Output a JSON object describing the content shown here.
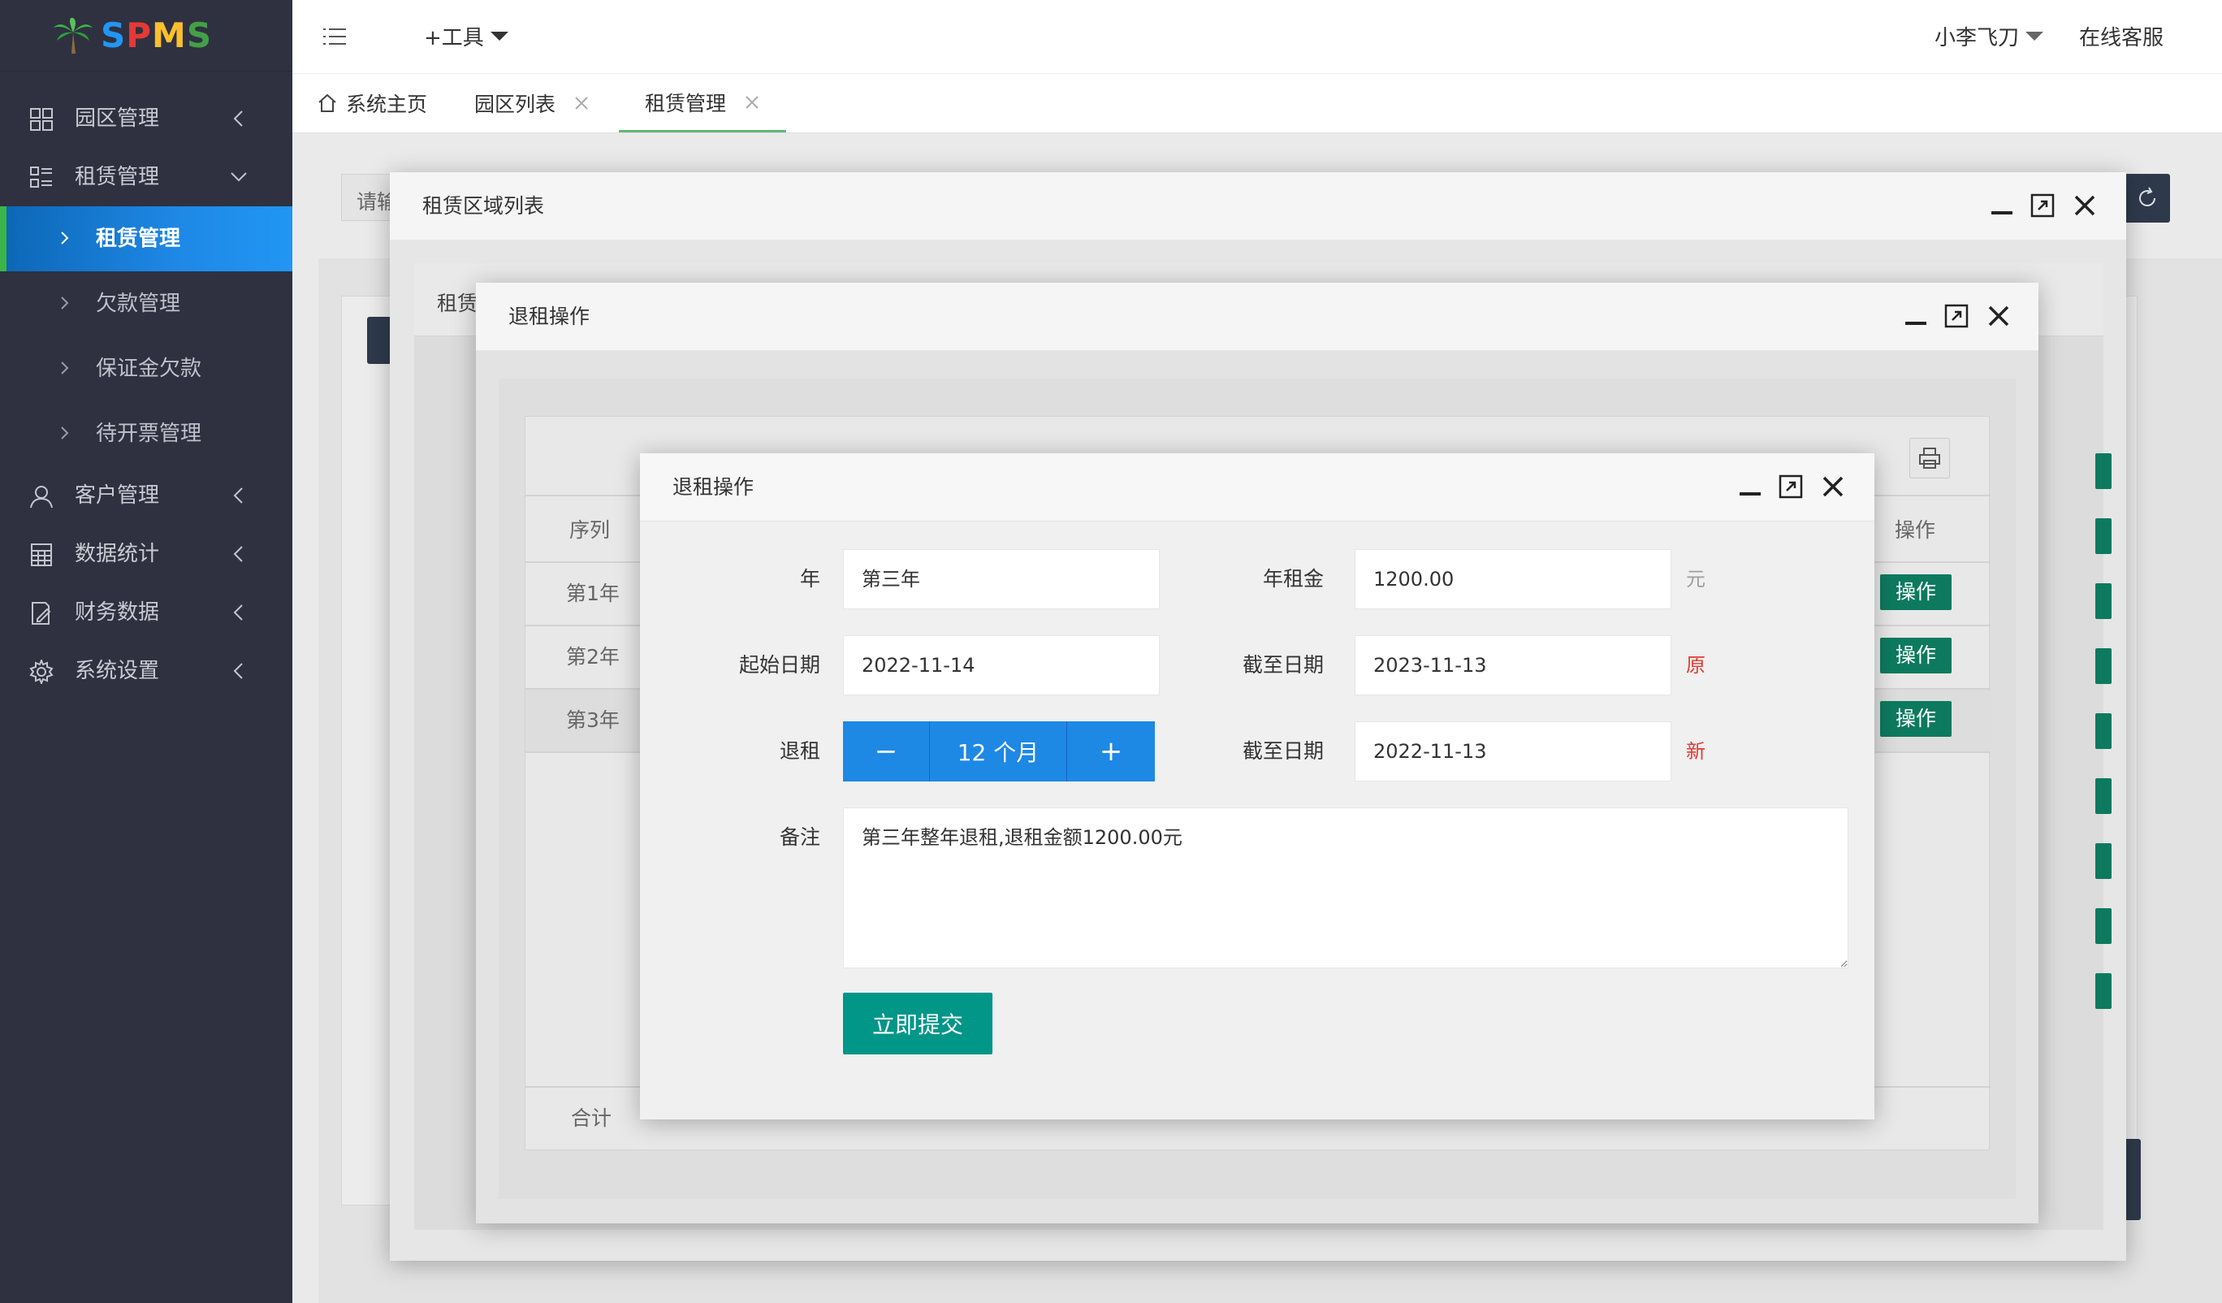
{
  "app": {
    "logo_text": "SPMS"
  },
  "sidebar": {
    "groups": [
      {
        "label": "园区管理",
        "icon": "grid-icon"
      },
      {
        "label": "租赁管理",
        "icon": "list-icon"
      },
      {
        "label": "客户管理",
        "icon": "user-icon"
      },
      {
        "label": "数据统计",
        "icon": "calculator-icon"
      },
      {
        "label": "财务数据",
        "icon": "document-edit-icon"
      },
      {
        "label": "系统设置",
        "icon": "gear-icon"
      }
    ],
    "lease_subitems": [
      {
        "label": "租赁管理"
      },
      {
        "label": "欠款管理"
      },
      {
        "label": "保证金欠款"
      },
      {
        "label": "待开票管理"
      }
    ]
  },
  "header": {
    "tools_label": "+工具",
    "user_name": "小李飞刀",
    "service_label": "在线客服"
  },
  "tabs": [
    {
      "label": "系统主页"
    },
    {
      "label": "园区列表"
    },
    {
      "label": "租赁管理"
    }
  ],
  "background": {
    "search_placeholder_fragment": "请输",
    "panel_title_fragment": "租赁",
    "table": {
      "col_serial": "序列",
      "col_action": "操作",
      "rows": [
        {
          "serial": "第1年",
          "action": "操作"
        },
        {
          "serial": "第2年",
          "action": "操作"
        },
        {
          "serial": "第3年",
          "action": "操作"
        }
      ],
      "total_label": "合计"
    }
  },
  "dialogs": {
    "outer_title": "租赁区域列表",
    "middle_title": "退租操作",
    "inner_title": "退租操作"
  },
  "form": {
    "year_label": "年",
    "year_value": "第三年",
    "annual_rent_label": "年租金",
    "annual_rent_value": "1200.00",
    "annual_rent_unit": "元",
    "start_date_label": "起始日期",
    "start_date_value": "2022-11-14",
    "end_date_label": "截至日期",
    "end_date_original": "2023-11-13",
    "original_tag": "原",
    "refund_label": "退租",
    "refund_months": "12 个月",
    "minus_symbol": "−",
    "plus_symbol": "+",
    "new_end_date_label": "截至日期",
    "new_end_date": "2022-11-13",
    "new_tag": "新",
    "remark_label": "备注",
    "remark_value": "第三年整年退租,退租金额1200.00元",
    "submit_label": "立即提交"
  },
  "colors": {
    "sidebar_bg": "#2f3140",
    "active_gradient": "#1e88e5",
    "primary_blue": "#1e88e5",
    "submit_teal": "#009688",
    "action_green": "#0d7a5f",
    "tag_red": "#e53935"
  }
}
